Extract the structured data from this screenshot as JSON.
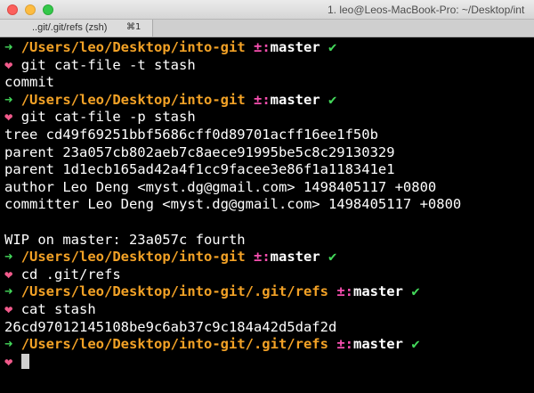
{
  "window": {
    "title": "1. leo@Leos-MacBook-Pro: ~/Desktop/int"
  },
  "tab": {
    "label": "..git/.git/refs (zsh)",
    "shortcut": "⌘1"
  },
  "terminal": {
    "lines": [
      {
        "kind": "prompt",
        "path": "/Users/leo/Desktop/into-git",
        "git_status": "±:",
        "branch": "master",
        "check": "✔"
      },
      {
        "kind": "command",
        "text": "git cat-file -t stash"
      },
      {
        "kind": "output",
        "text": "commit"
      },
      {
        "kind": "prompt",
        "path": "/Users/leo/Desktop/into-git",
        "git_status": "±:",
        "branch": "master",
        "check": "✔"
      },
      {
        "kind": "command",
        "text": "git cat-file -p stash"
      },
      {
        "kind": "output",
        "text": "tree cd49f69251bbf5686cff0d89701acff16ee1f50b"
      },
      {
        "kind": "output",
        "text": "parent 23a057cb802aeb7c8aece91995be5c8c29130329"
      },
      {
        "kind": "output",
        "text": "parent 1d1ecb165ad42a4f1cc9facee3e86f1a118341e1"
      },
      {
        "kind": "output",
        "text": "author Leo Deng <myst.dg@gmail.com> 1498405117 +0800"
      },
      {
        "kind": "output",
        "text": "committer Leo Deng <myst.dg@gmail.com> 1498405117 +0800"
      },
      {
        "kind": "output",
        "text": ""
      },
      {
        "kind": "output",
        "text": "WIP on master: 23a057c fourth"
      },
      {
        "kind": "prompt",
        "path": "/Users/leo/Desktop/into-git",
        "git_status": "±:",
        "branch": "master",
        "check": "✔"
      },
      {
        "kind": "command",
        "text": "cd .git/refs"
      },
      {
        "kind": "prompt",
        "path": "/Users/leo/Desktop/into-git/.git/refs",
        "git_status": "±:",
        "branch": "master",
        "check": "✔"
      },
      {
        "kind": "command",
        "text": "cat stash"
      },
      {
        "kind": "output",
        "text": "26cd97012145108be9c6ab37c9c184a42d5daf2d"
      },
      {
        "kind": "prompt",
        "path": "/Users/leo/Desktop/into-git/.git/refs",
        "git_status": "±:",
        "branch": "master",
        "check": "✔"
      },
      {
        "kind": "input",
        "text": ""
      }
    ],
    "prompt_arrow": "➜",
    "command_marker": "❤"
  },
  "colors": {
    "background": "#000000",
    "arrow": "#43d75a",
    "path": "#f3a226",
    "git_status": "#f74fb0",
    "check": "#43d75a",
    "heart": "#f15a8b",
    "text": "#ffffff"
  },
  "icons": {
    "close": "close-button-red",
    "minimize": "minimize-button-yellow",
    "maximize": "zoom-button-green"
  }
}
